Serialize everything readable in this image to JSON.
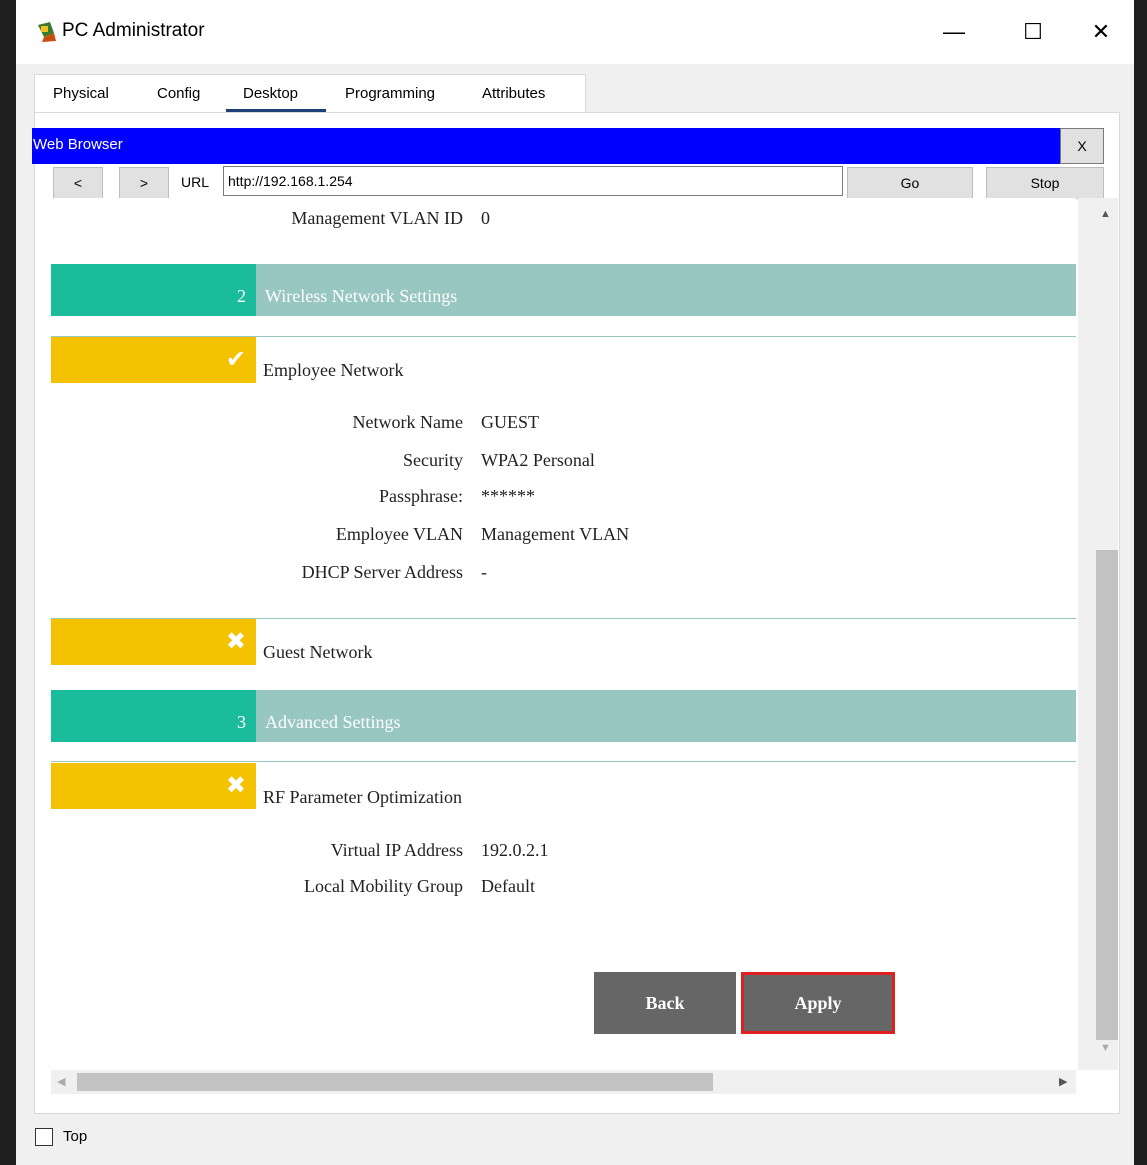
{
  "window": {
    "title": "PC Administrator",
    "minimize_glyph": "—",
    "maximize_glyph": "☐",
    "close_glyph": "✕"
  },
  "tabs": [
    {
      "label": "Physical"
    },
    {
      "label": "Config"
    },
    {
      "label": "Desktop",
      "active": true
    },
    {
      "label": "Programming"
    },
    {
      "label": "Attributes"
    }
  ],
  "browser": {
    "title": "Web Browser",
    "close_label": "X",
    "back_label": "<",
    "forward_label": ">",
    "url_label": "URL",
    "url_value": "http://192.168.1.254",
    "go_label": "Go",
    "stop_label": "Stop"
  },
  "page": {
    "management_vlan": {
      "label": "Management VLAN ID",
      "value": "0"
    },
    "section2": {
      "number": "2",
      "title": "Wireless Network Settings"
    },
    "employee_network": {
      "status": "enabled",
      "status_glyph": "✔",
      "title": "Employee Network",
      "fields": [
        {
          "label": "Network Name",
          "value": "GUEST"
        },
        {
          "label": "Security",
          "value": "WPA2 Personal"
        },
        {
          "label": "Passphrase:",
          "value": "******"
        },
        {
          "label": "Employee VLAN",
          "value": "Management VLAN"
        },
        {
          "label": "DHCP Server Address",
          "value": "-"
        }
      ]
    },
    "guest_network": {
      "status": "disabled",
      "status_glyph": "✖",
      "title": "Guest Network"
    },
    "section3": {
      "number": "3",
      "title": "Advanced Settings"
    },
    "rf_optimization": {
      "status": "disabled",
      "status_glyph": "✖",
      "title": "RF Parameter Optimization",
      "fields": [
        {
          "label": "Virtual IP Address",
          "value": "192.0.2.1"
        },
        {
          "label": "Local Mobility Group",
          "value": "Default"
        }
      ]
    },
    "back_button": "Back",
    "apply_button": "Apply"
  },
  "footer": {
    "top_label": "Top",
    "top_checked": false
  },
  "colors": {
    "browser_bar": "#0000ff",
    "section_number": "#1abc9c",
    "section_header": "#98c6c0",
    "status_yellow": "#f4c200",
    "button_grey": "#666666",
    "apply_highlight": "#e02020"
  }
}
